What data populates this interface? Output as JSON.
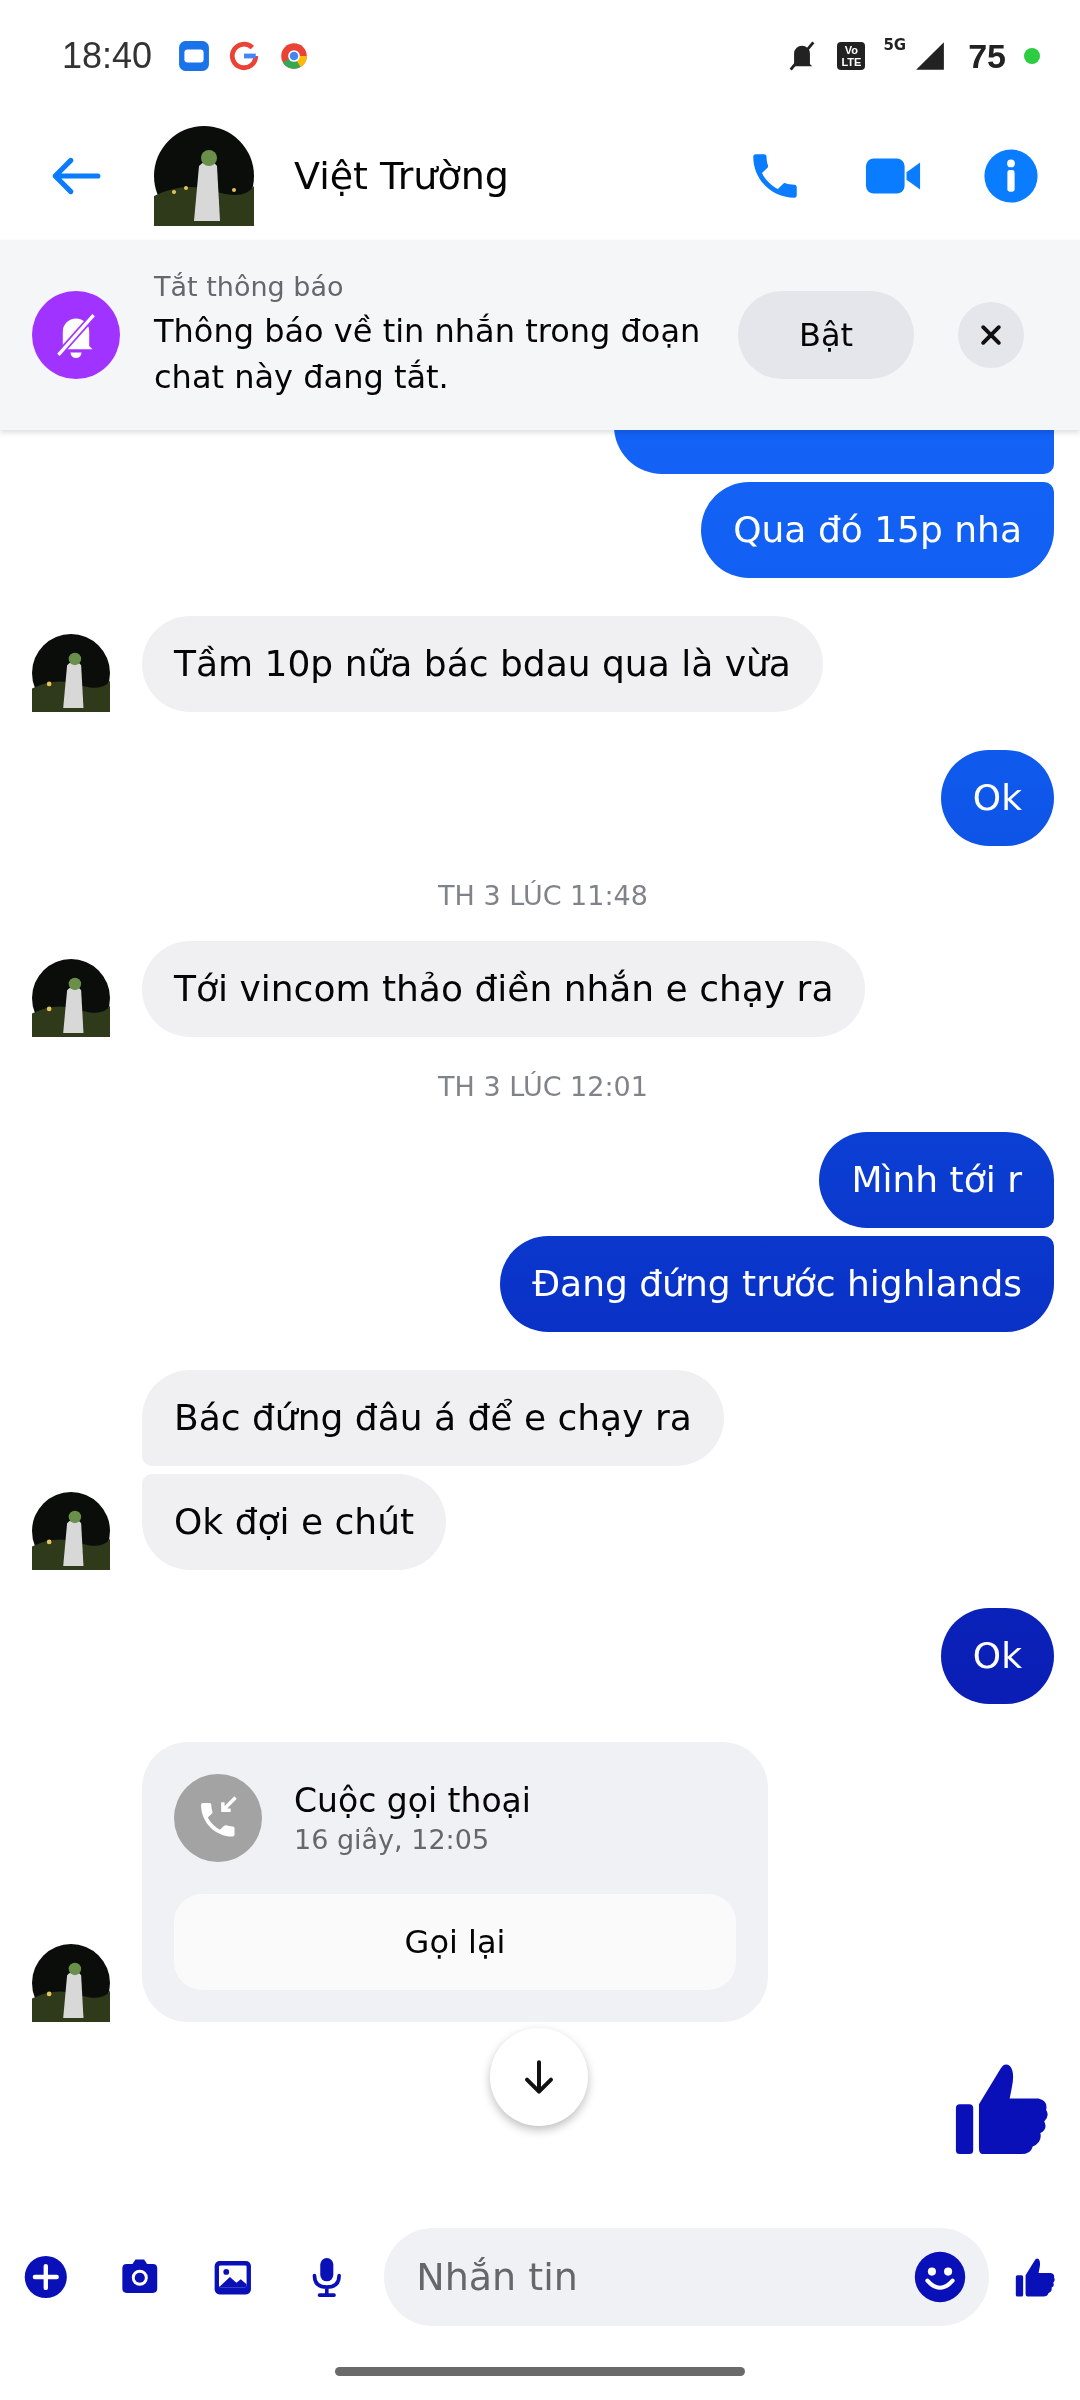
{
  "status_bar": {
    "time": "18:40",
    "volte_top": "Vo",
    "volte_bottom": "LTE",
    "network": "5G",
    "battery": "75"
  },
  "header": {
    "name": "Việt Trường"
  },
  "banner": {
    "title": "Tắt thông báo",
    "text": "Thông báo về tin nhắn trong đoạn chat này đang tắt.",
    "button": "Bật"
  },
  "messages": [
    {
      "kind": "outgoing"
    },
    {
      "kind": "outgoing",
      "text": "Qua đó 15p nha"
    },
    {
      "kind": "incoming",
      "text": "Tầm 10p nữa bác bdau qua là vừa",
      "avatar": true
    },
    {
      "kind": "outgoing",
      "text": "Ok"
    },
    {
      "kind": "timestamp",
      "text": "TH 3 LÚC 11:48"
    },
    {
      "kind": "incoming",
      "text": "Tới vincom thảo điền nhắn e chạy ra",
      "avatar": true
    },
    {
      "kind": "timestamp",
      "text": "TH 3 LÚC 12:01"
    },
    {
      "kind": "outgoing",
      "text": "Mình tới r"
    },
    {
      "kind": "outgoing",
      "text": "Đang đứng trước highlands"
    },
    {
      "kind": "incoming",
      "text": "Bác đứng đâu á để e chạy ra",
      "avatar": false
    },
    {
      "kind": "incoming",
      "text": "Ok đợi e chút",
      "avatar": true
    },
    {
      "kind": "outgoing",
      "text": "Ok"
    },
    {
      "kind": "call",
      "title": "Cuộc gọi thoại",
      "detail": "16 giây, 12:05",
      "button": "Gọi lại",
      "avatar": true
    },
    {
      "kind": "like"
    }
  ],
  "composer": {
    "placeholder": "Nhắn tin"
  }
}
